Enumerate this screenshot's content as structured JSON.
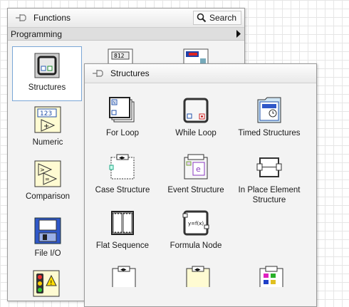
{
  "functions_palette": {
    "title": "Functions",
    "search_label": "Search",
    "category": "Programming",
    "items": [
      {
        "label": "Structures",
        "icon": "structures-icon"
      },
      {
        "label": "Numeric",
        "icon": "numeric-icon"
      },
      {
        "label": "Comparison",
        "icon": "comparison-icon"
      },
      {
        "label": "File I/O",
        "icon": "file-io-icon"
      }
    ]
  },
  "structures_palette": {
    "title": "Structures",
    "items": [
      {
        "label": "For Loop",
        "icon": "for-loop-icon"
      },
      {
        "label": "While Loop",
        "icon": "while-loop-icon"
      },
      {
        "label": "Timed Structures",
        "icon": "timed-structures-icon"
      },
      {
        "label": "Case Structure",
        "icon": "case-structure-icon"
      },
      {
        "label": "Event Structure",
        "icon": "event-structure-icon"
      },
      {
        "label": "In Place Element Structure",
        "icon": "in-place-element-icon"
      },
      {
        "label": "Flat Sequence",
        "icon": "flat-sequence-icon"
      },
      {
        "label": "Formula Node",
        "icon": "formula-node-icon"
      }
    ]
  }
}
